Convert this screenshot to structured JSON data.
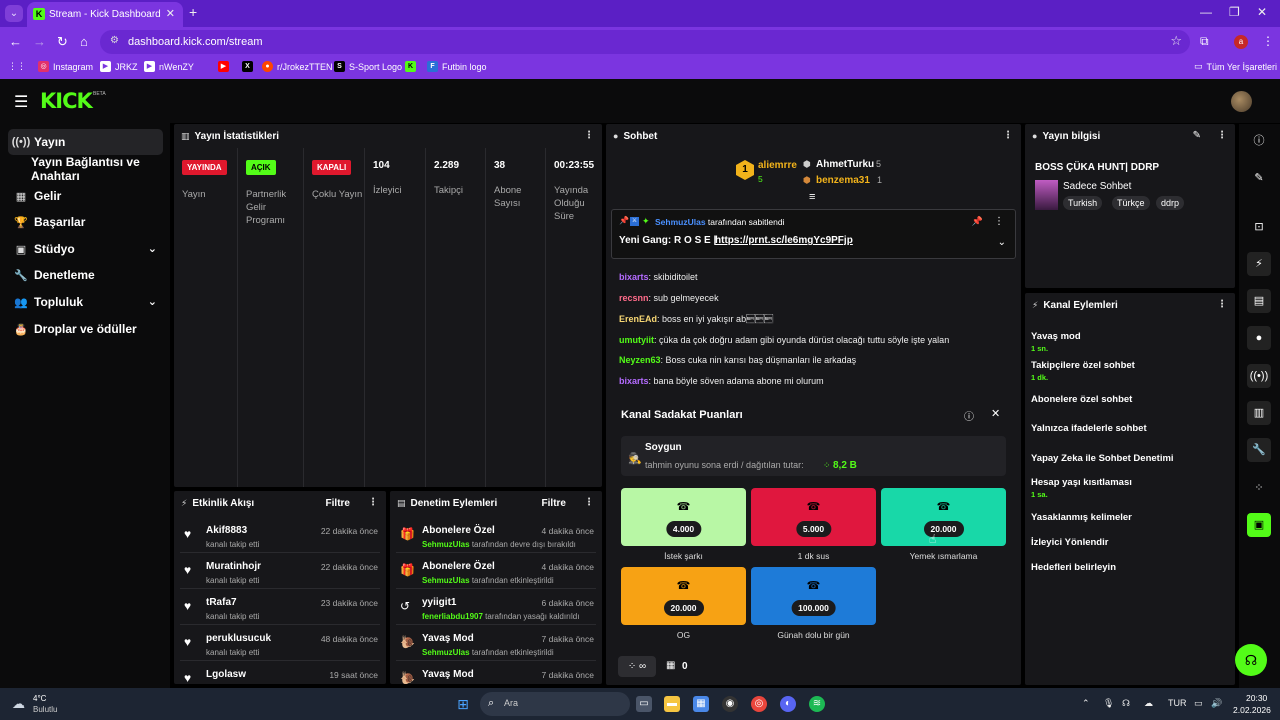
{
  "browser": {
    "tab_title": "Stream - Kick Dashboard",
    "tab_close": "✕",
    "new_tab": "+",
    "url": "dashboard.kick.com/stream",
    "profile_letter": "a",
    "bookmarks": [
      "Instagram",
      "JRKZ",
      "nWenZY",
      "r/JrokezTTEN",
      "S-Sport Logo",
      "Futbin logo"
    ],
    "all_bookmarks": "Tüm Yer İşaretleri"
  },
  "header": {
    "logo": "KICK",
    "beta": "BETA"
  },
  "sidebar": {
    "items": [
      {
        "icon": "((•))",
        "label": "Yayın"
      },
      {
        "icon": "",
        "label": "Yayın Bağlantısı ve Anahtarı"
      },
      {
        "icon": "▦",
        "label": "Gelir"
      },
      {
        "icon": "🏆",
        "label": "Başarılar"
      },
      {
        "icon": "▣",
        "label": "Stüdyo"
      },
      {
        "icon": "🔧",
        "label": "Denetleme"
      },
      {
        "icon": "👥",
        "label": "Topluluk"
      },
      {
        "icon": "🎂",
        "label": "Droplar ve ödüller"
      }
    ]
  },
  "stats": {
    "title": "Yayın İstatistikleri",
    "cols": [
      {
        "badge": "YAYINDA",
        "badge_color": "#e0182d",
        "label": "Yayın"
      },
      {
        "badge": "AÇIK",
        "badge_color": "#53fc18",
        "label": "Partnerlik Gelir Programı"
      },
      {
        "badge": "KAPALI",
        "badge_color": "#e0182d",
        "label": "Çoklu Yayın"
      },
      {
        "value": "104",
        "label": "İzleyici"
      },
      {
        "value": "2.289",
        "label": "Takipçi"
      },
      {
        "value": "38",
        "label": "Abone Sayısı"
      },
      {
        "value": "00:23:55",
        "label": "Yayında Olduğu Süre"
      }
    ]
  },
  "activity": {
    "title": "Etkinlik Akışı",
    "filter": "Filtre",
    "items": [
      {
        "name": "Akif8883",
        "sub": "kanalı takip etti",
        "time": "22 dakika önce"
      },
      {
        "name": "Muratinhojr",
        "sub": "kanalı takip etti",
        "time": "22 dakika önce"
      },
      {
        "name": "tRafa7",
        "sub": "kanalı takip etti",
        "time": "23 dakika önce"
      },
      {
        "name": "peruklusucuk",
        "sub": "kanalı takip etti",
        "time": "48 dakika önce"
      },
      {
        "name": "Lgolasw",
        "sub": "",
        "time": "19 saat önce"
      }
    ]
  },
  "moderation": {
    "title": "Denetim Eylemleri",
    "filter": "Filtre",
    "items": [
      {
        "icon": "🎁",
        "name": "Abonelere Özel",
        "user": "SehmuzUlas",
        "sub": "tarafından devre dışı bırakıldı",
        "time": "4 dakika önce"
      },
      {
        "icon": "🎁",
        "name": "Abonelere Özel",
        "user": "SehmuzUlas",
        "sub": "tarafından etkinleştirildi",
        "time": "4 dakika önce"
      },
      {
        "icon": "↺",
        "name": "yyiigit1",
        "user": "fenerliabdu1907",
        "sub": "tarafından yasağı kaldırıldı",
        "time": "6 dakika önce"
      },
      {
        "icon": "🐌",
        "name": "Yavaş Mod",
        "user": "SehmuzUlas",
        "sub": "tarafından etkinleştirildi",
        "time": "7 dakika önce"
      },
      {
        "icon": "🐌",
        "name": "Yavaş Mod",
        "user": "",
        "sub": "",
        "time": "7 dakika önce"
      }
    ]
  },
  "chat": {
    "title": "Sohbet",
    "top1_name": "aliemrre",
    "top1_count": "5",
    "top2_name": "AhmetTurku",
    "top2_count": "5",
    "top3_name": "benzema31",
    "top3_count": "1",
    "pinned_by": "SehmuzUlas",
    "pinned_suffix": "tarafından sabitlendi",
    "pinned_prefix": "Yeni Gang: R O S E |",
    "pinned_link": "https://prnt.sc/le6mgYc9PFjp",
    "messages": [
      {
        "user": "bixarts",
        "color": "#b46bff",
        "text": "skibiditoilet"
      },
      {
        "user": "recsnn",
        "color": "#ff6b8a",
        "text": "sub gelmeyecek"
      },
      {
        "user": "ErenEAd",
        "color": "#f7d774",
        "text": "boss en iyi yakışır ab\u0019\u0019\u0019"
      },
      {
        "user": "umutyiit",
        "color": "#53fc18",
        "text": "çüka da çok doğru adam gibi oyunda dürüst olacağı tuttu söyle işte yalan"
      },
      {
        "user": "Neyzen63",
        "color": "#53fc18",
        "text": "Boss cuka nin karısı baş düşmanları ile arkadaş"
      },
      {
        "user": "bixarts",
        "color": "#b46bff",
        "text": "bana böyle söven adama abone mi olurum"
      }
    ]
  },
  "loyalty": {
    "title": "Kanal Sadakat Puanları",
    "robbery_title": "Soygun",
    "robbery_sub": "tahmin oyunu sona erdi / dağıtılan tutar:",
    "robbery_amount": "8,2 B",
    "rewards": [
      {
        "cost": "4.000",
        "label": "İstek şarkı",
        "color": "#b8f7a5"
      },
      {
        "cost": "5.000",
        "label": "1 dk sus",
        "color": "#e0173e"
      },
      {
        "cost": "20.000",
        "label": "Yemek ısmarlama",
        "color": "#18d8a8"
      },
      {
        "cost": "20.000",
        "label": "OG",
        "color": "#f7a214"
      },
      {
        "cost": "100.000",
        "label": "Günah dolu bir gün",
        "color": "#1e7bd8"
      }
    ],
    "points_value": "∞",
    "store_count": "0"
  },
  "stream_info": {
    "title": "Yayın bilgisi",
    "stream_title": "BOSS ÇÜKA HUNT| DDRP",
    "category": "Sadece Sohbet",
    "tags": [
      "Turkish",
      "Türkçe",
      "ddrp"
    ]
  },
  "channel_actions": {
    "title": "Kanal Eylemleri",
    "items": [
      {
        "label": "Yavaş mod",
        "sub": "1 sn.",
        "control": "arrow"
      },
      {
        "label": "Takipçilere özel sohbet",
        "sub": "1 dk.",
        "control": "arrow"
      },
      {
        "label": "Abonelere özel sohbet",
        "sub": "",
        "control": "toggle"
      },
      {
        "label": "Yalnızca ifadelerle sohbet",
        "sub": "",
        "control": "toggle"
      },
      {
        "label": "Yapay Zeka ile Sohbet Denetimi",
        "sub": "",
        "control": "external"
      },
      {
        "label": "Hesap yaşı kısıtlaması",
        "sub": "1 sa.",
        "control": "arrow"
      },
      {
        "label": "Yasaklanmış kelimeler",
        "sub": "",
        "control": "arrow"
      },
      {
        "label": "İzleyici Yönlendir",
        "sub": "",
        "control": "none"
      },
      {
        "label": "Hedefleri belirleyin",
        "sub": "",
        "control": "arrow"
      }
    ]
  },
  "taskbar": {
    "weather_temp": "4°C",
    "weather_desc": "Bulutlu",
    "search_placeholder": "Ara",
    "lang": "TUR",
    "time": "20:30",
    "date": "2.02.2026"
  }
}
